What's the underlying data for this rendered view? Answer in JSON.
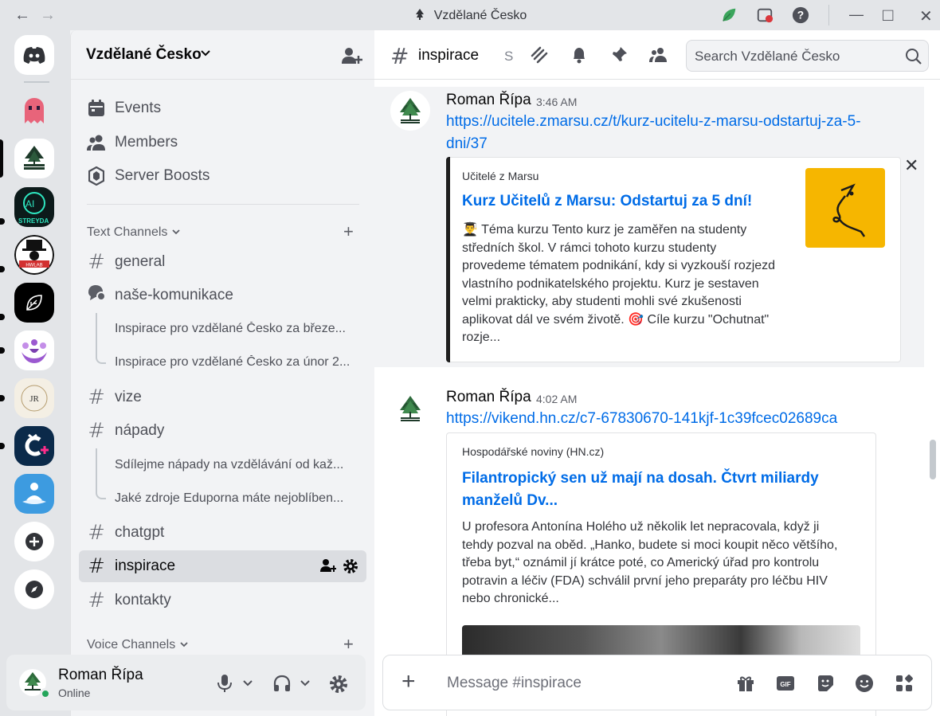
{
  "window": {
    "title": "Vzdělané Česko",
    "back_icon": "arrow-left-icon",
    "forward_icon": "arrow-right-icon"
  },
  "guild": {
    "name": "Vzdělané Česko",
    "nav": [
      {
        "label": "Events",
        "icon": "calendar-icon"
      },
      {
        "label": "Members",
        "icon": "members-icon"
      },
      {
        "label": "Server Boosts",
        "icon": "boost-icon"
      }
    ]
  },
  "categories": {
    "text": "Text Channels",
    "voice": "Voice Channels"
  },
  "channels": {
    "general": "general",
    "nase": "naše-komunikace",
    "thread1": "Inspirace pro vzdělané Česko za březe...",
    "thread2": "Inspirace pro vzdělané Česko za únor 2...",
    "vize": "vize",
    "napady": "nápady",
    "thread3": "Sdílejme nápady na vzdělávání  od kaž...",
    "thread4": "Jaké zdroje Eduporna máte nejoblíben...",
    "chatgpt": "chatgpt",
    "inspirace": "inspirace",
    "kontakty": "kontakty"
  },
  "user": {
    "name": "Roman Řípa",
    "status": "Online"
  },
  "header": {
    "channel": "inspirace",
    "topic": "S",
    "search_placeholder": "Search Vzdělané Česko"
  },
  "messages": [
    {
      "author": "Roman Řípa",
      "time": "3:46 AM",
      "link_line1": "https://ucitele.zmarsu.cz/t/kurz-ucitelu-z-marsu-odstartuj-za-5-",
      "link_line2": "dni/37",
      "embed": {
        "provider": "Učitelé z Marsu",
        "title": "Kurz Učitelů z Marsu: Odstartuj za 5 dní!",
        "desc": [
          "👨‍🎓 Téma kurzu Tento kurz je zaměřen na studenty",
          "středních škol. V rámci tohoto kurzu studenty",
          "provedeme tématem podnikání, kdy si vyzkouší rozjezd",
          "vlastního podnikatelského projektu. Kurz je sestaven",
          "velmi prakticky, aby studenti mohli své zkušenosti",
          "aplikovat dál ve svém životě. 🎯 Cíle kurzu \"Ochutnat\"",
          "rozje..."
        ]
      }
    },
    {
      "author": "Roman Řípa",
      "time": "4:02 AM",
      "link_line1": "https://vikend.hn.cz/c7-67830670-141kjf-1c39fcec02689ca",
      "embed": {
        "provider": "Hospodářské noviny (HN.cz)",
        "title_line1": "Filantropický sen už mají na dosah. Čtvrt miliardy",
        "title_line2": "manželů Dv...",
        "desc": [
          "U profesora Antonína Holého už několik let nepracovala, když ji",
          "tehdy pozval na oběd. „Hanko, budete si moci koupit něco většího,",
          "třeba byt,“ oznámil jí krátce poté, co Americký úřad pro kontrolu",
          "potravin a léčiv (FDA) schválil první jeho preparáty pro léčbu HIV",
          "nebo chronické..."
        ]
      }
    }
  ],
  "composer": {
    "placeholder": "Message #inspirace"
  },
  "servers": [
    {
      "name": "discord-home",
      "icon": "discord-icon"
    },
    {
      "name": "ghost-server",
      "icon": "ghost-icon"
    },
    {
      "name": "vzdelane-cesko",
      "icon": "tree-icon"
    },
    {
      "name": "ai-streyda",
      "icon": "ai-streyda-icon"
    },
    {
      "name": "hwlab",
      "icon": "hwlab-icon"
    },
    {
      "name": "leaf-server",
      "icon": "leaf-icon"
    },
    {
      "name": "people-server",
      "icon": "people-icon"
    },
    {
      "name": "jr-server",
      "icon": "jr-icon"
    },
    {
      "name": "c-plus-server",
      "icon": "c-plus-icon"
    },
    {
      "name": "meditation-server",
      "icon": "meditation-icon"
    },
    {
      "name": "add-server",
      "icon": "plus-icon"
    },
    {
      "name": "discover",
      "icon": "compass-icon"
    }
  ],
  "colors": {
    "accent_link": "#006ce7",
    "online": "#23a55a",
    "embed_thumb": "#f6b600"
  }
}
